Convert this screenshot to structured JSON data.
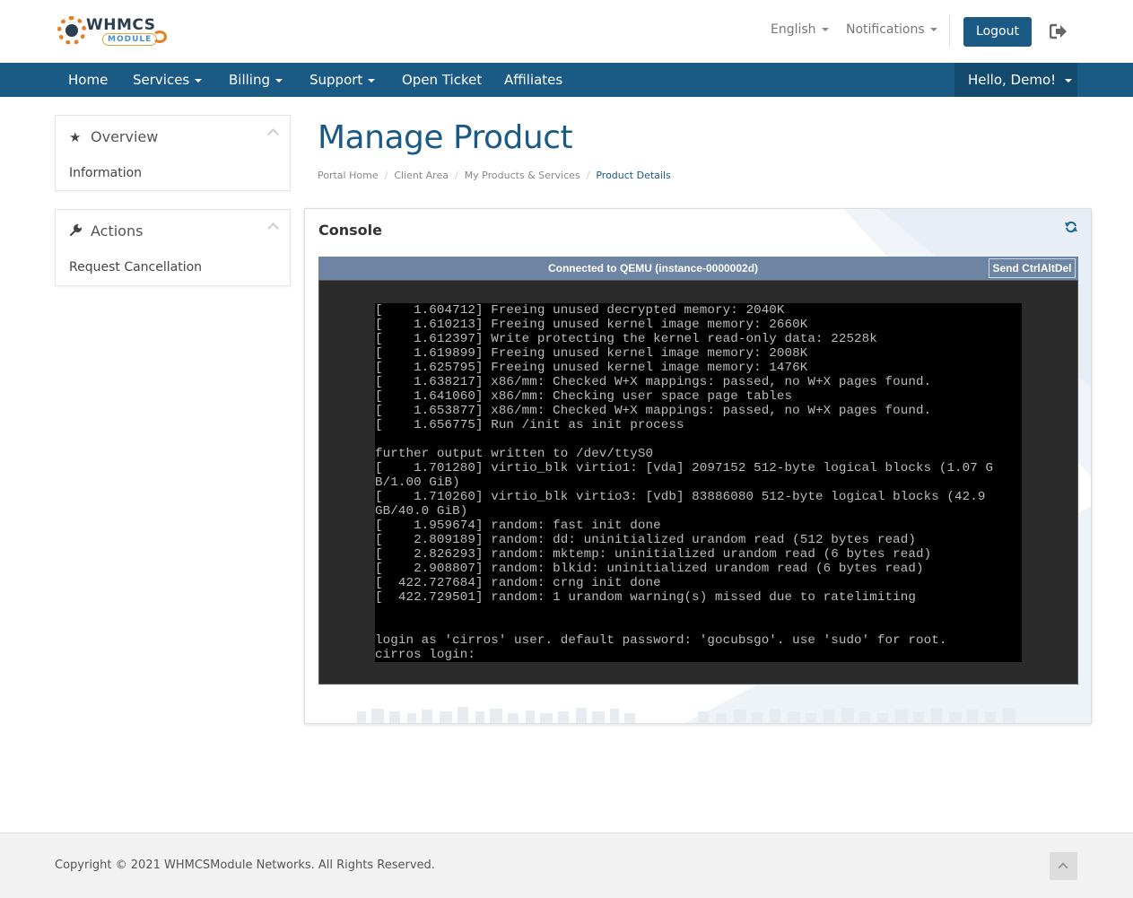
{
  "header": {
    "logo_text": "WHMCS",
    "logo_sub": "MODULE",
    "language": "English",
    "notifications": "Notifications",
    "logout": "Logout"
  },
  "nav": {
    "items": [
      {
        "label": "Home",
        "dropdown": false
      },
      {
        "label": "Services",
        "dropdown": true
      },
      {
        "label": "Billing",
        "dropdown": true
      },
      {
        "label": "Support",
        "dropdown": true
      },
      {
        "label": "Open Ticket",
        "dropdown": false
      },
      {
        "label": "Affiliates",
        "dropdown": false
      }
    ],
    "user_menu": "Hello, Demo!"
  },
  "sidebar": {
    "overview": {
      "title": "Overview",
      "icon": "star-icon",
      "items": [
        "Information"
      ]
    },
    "actions": {
      "title": "Actions",
      "icon": "wrench-icon",
      "items": [
        "Request Cancellation"
      ]
    }
  },
  "page": {
    "title": "Manage Product",
    "breadcrumb": [
      "Portal Home",
      "Client Area",
      "My Products & Services",
      "Product Details"
    ]
  },
  "console": {
    "title": "Console",
    "status": "Connected to QEMU (instance-0000002d)",
    "send_button": "Send CtrlAltDel",
    "lines": [
      "[    1.604712] Freeing unused decrypted memory: 2040K",
      "[    1.610213] Freeing unused kernel image memory: 2660K",
      "[    1.612397] Write protecting the kernel read-only data: 22528k",
      "[    1.619899] Freeing unused kernel image memory: 2008K",
      "[    1.625795] Freeing unused kernel image memory: 1476K",
      "[    1.638217] x86/mm: Checked W+X mappings: passed, no W+X pages found.",
      "[    1.641060] x86/mm: Checking user space page tables",
      "[    1.653877] x86/mm: Checked W+X mappings: passed, no W+X pages found.",
      "[    1.656775] Run /init as init process",
      "",
      "further output written to /dev/ttyS0",
      "[    1.701280] virtio_blk virtio1: [vda] 2097152 512-byte logical blocks (1.07 G",
      "B/1.00 GiB)",
      "[    1.710260] virtio_blk virtio3: [vdb] 83886080 512-byte logical blocks (42.9",
      "GB/40.0 GiB)",
      "[    1.959674] random: fast init done",
      "[    2.809189] random: dd: uninitialized urandom read (512 bytes read)",
      "[    2.826293] random: mktemp: uninitialized urandom read (6 bytes read)",
      "[    2.908807] random: blkid: uninitialized urandom read (6 bytes read)",
      "[  422.727684] random: crng init done",
      "[  422.729501] random: 1 urandom warning(s) missed due to ratelimiting",
      "",
      "",
      "login as 'cirros' user. default password: 'gocubsgo'. use 'sudo' for root.",
      "cirros login:"
    ]
  },
  "footer": {
    "copyright": "Copyright © 2021 WHMCSModule Networks. All Rights Reserved."
  }
}
